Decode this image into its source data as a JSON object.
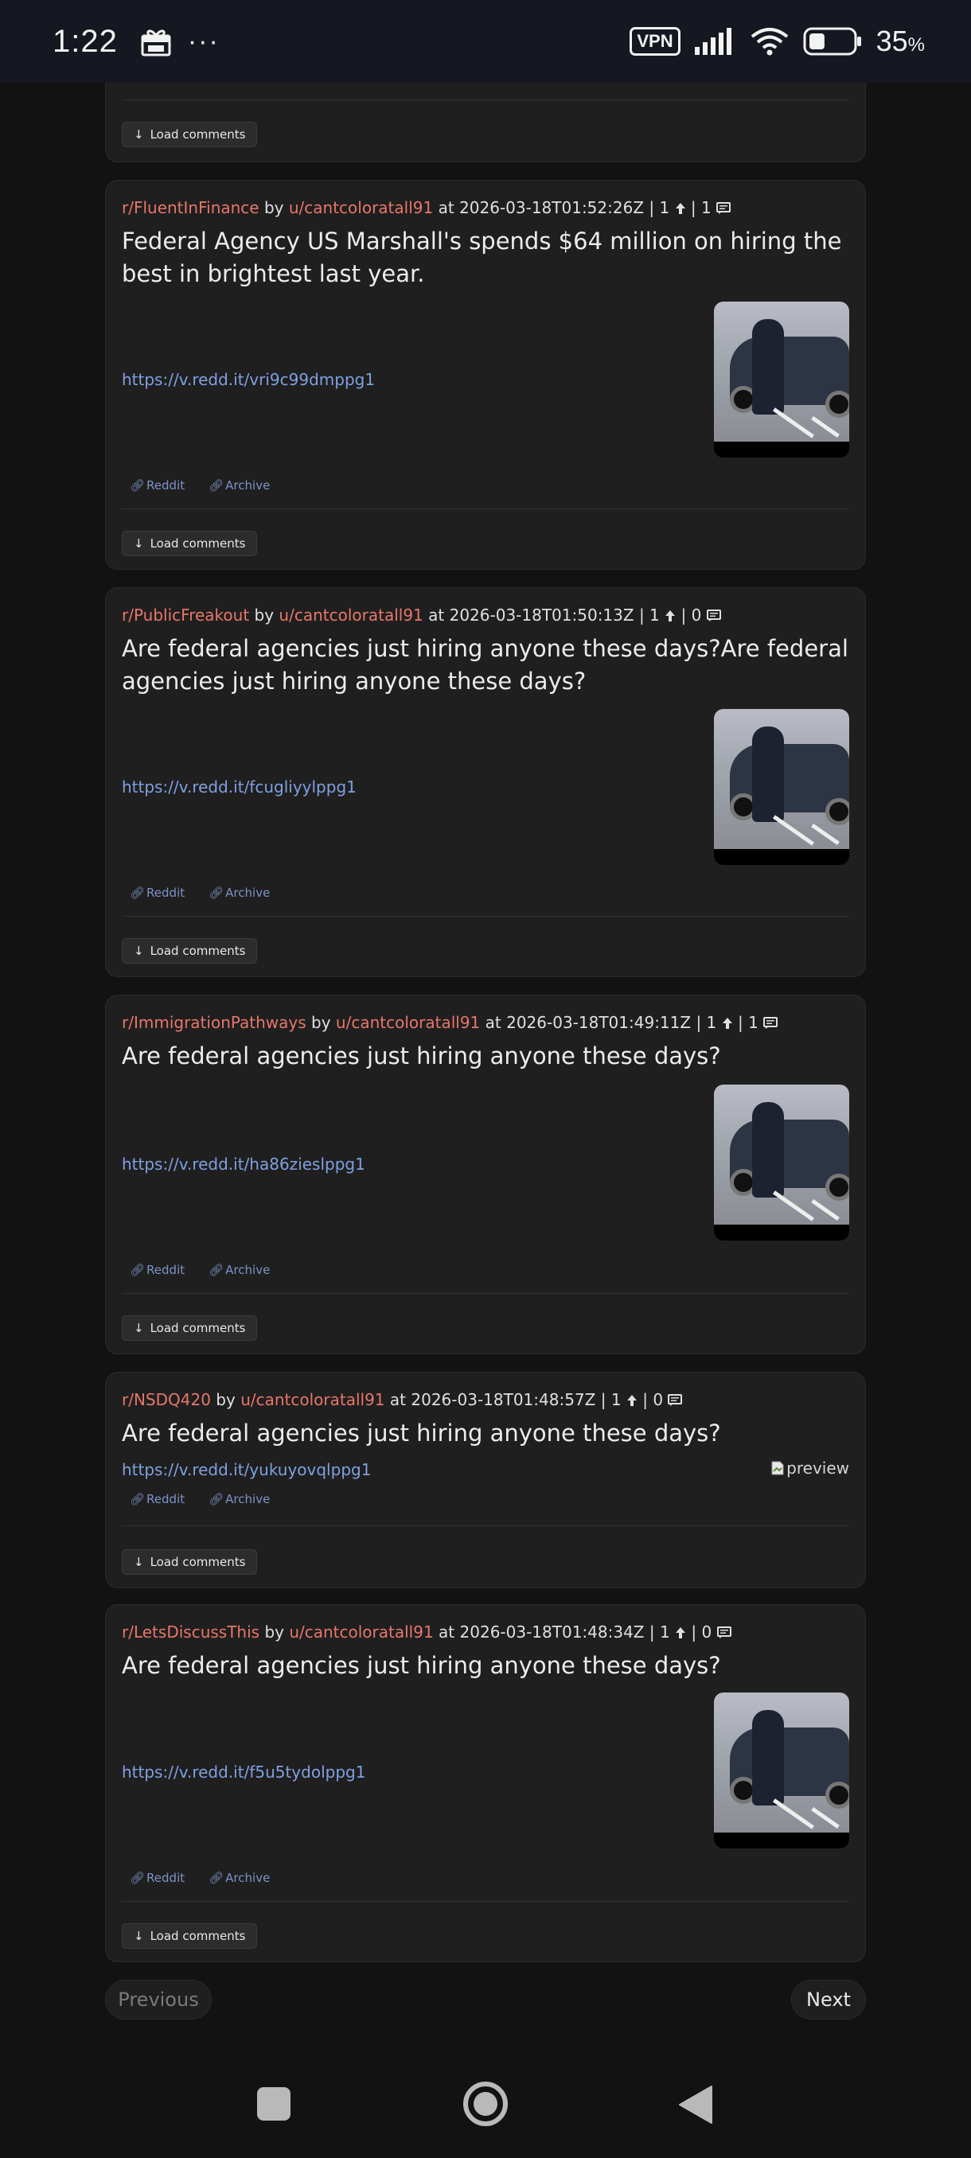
{
  "status_bar": {
    "time": "1:22",
    "dots": "···",
    "vpn": "VPN",
    "battery_percent": "35",
    "battery_unit": "%",
    "battery_level": 0.35
  },
  "common": {
    "by": "by",
    "at": "at",
    "reddit_label": "Reddit",
    "archive_label": "Archive",
    "load_comments_label": "Load comments",
    "preview_alt": "preview"
  },
  "posts": [
    {
      "subreddit": "r/FluentInFinance",
      "user": "u/cantcoloratall91",
      "timestamp": "2026-03-18T01:52:26Z",
      "score": "1",
      "comments": "1",
      "title": "Federal Agency US Marshall's spends $64 million on hiring the best in brightest last year.",
      "link": "https://v.redd.it/vri9c99dmppg1"
    },
    {
      "subreddit": "r/PublicFreakout",
      "user": "u/cantcoloratall91",
      "timestamp": "2026-03-18T01:50:13Z",
      "score": "1",
      "comments": "0",
      "title": "Are federal agencies just hiring anyone these days?Are federal agencies just hiring anyone these days?",
      "link": "https://v.redd.it/fcugliyylppg1"
    },
    {
      "subreddit": "r/ImmigrationPathways",
      "user": "u/cantcoloratall91",
      "timestamp": "2026-03-18T01:49:11Z",
      "score": "1",
      "comments": "1",
      "title": "Are federal agencies just hiring anyone these days?",
      "link": "https://v.redd.it/ha86zieslppg1"
    },
    {
      "subreddit": "r/NSDQ420",
      "user": "u/cantcoloratall91",
      "timestamp": "2026-03-18T01:48:57Z",
      "score": "1",
      "comments": "0",
      "title": "Are federal agencies just hiring anyone these days?",
      "link": "https://v.redd.it/yukuyovqlppg1"
    },
    {
      "subreddit": "r/LetsDiscussThis",
      "user": "u/cantcoloratall91",
      "timestamp": "2026-03-18T01:48:34Z",
      "score": "1",
      "comments": "0",
      "title": "Are federal agencies just hiring anyone these days?",
      "link": "https://v.redd.it/f5u5tydolppg1"
    }
  ],
  "pagination": {
    "previous_label": "Previous",
    "next_label": "Next"
  },
  "colors": {
    "background": "#121212",
    "card": "#1f1f1f",
    "accent_red": "#e8766b",
    "link_blue": "#7fa0e0"
  }
}
